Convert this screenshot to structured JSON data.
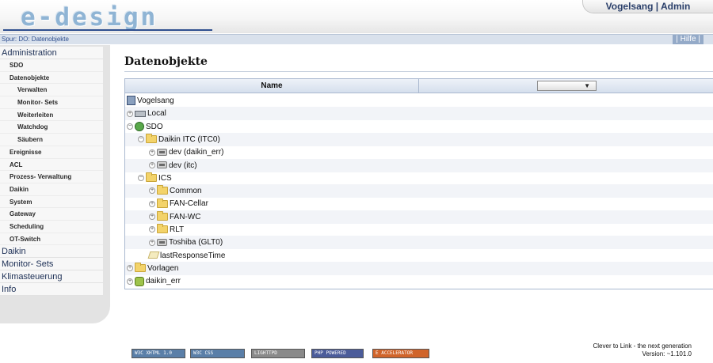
{
  "header": {
    "logo_text": "e-design",
    "user_label": "Vogelsang | Admin",
    "trail": "Spur: DO: Datenobjekte",
    "help_label": "| Hilfe |"
  },
  "sidebar": {
    "items": [
      {
        "label": "Administration",
        "level": 0
      },
      {
        "label": "SDO",
        "level": 1
      },
      {
        "label": "Datenobjekte",
        "level": 1
      },
      {
        "label": "Verwalten",
        "level": 2
      },
      {
        "label": "Monitor- Sets",
        "level": 2
      },
      {
        "label": "Weiterleiten",
        "level": 2
      },
      {
        "label": "Watchdog",
        "level": 2
      },
      {
        "label": "Säubern",
        "level": 2
      },
      {
        "label": "Ereignisse",
        "level": 1
      },
      {
        "label": "ACL",
        "level": 1
      },
      {
        "label": "Prozess- Verwaltung",
        "level": 1
      },
      {
        "label": "Daikin",
        "level": 1
      },
      {
        "label": "System",
        "level": 1
      },
      {
        "label": "Gateway",
        "level": 1
      },
      {
        "label": "Scheduling",
        "level": 1
      },
      {
        "label": "OT-Switch",
        "level": 1
      },
      {
        "label": "Daikin",
        "level": 0
      },
      {
        "label": "Monitor- Sets",
        "level": 0
      },
      {
        "label": "Klimasteuerung",
        "level": 0
      },
      {
        "label": "Info",
        "level": 0
      }
    ]
  },
  "main": {
    "title": "Datenobjekte",
    "column_name": "Name",
    "filter_value": "",
    "filter_arrow": "▼",
    "tree": [
      {
        "label": "Vogelsang",
        "depth": 0,
        "icon": "server-icon",
        "toggle": ""
      },
      {
        "label": "Local",
        "depth": 0,
        "icon": "drive-icon",
        "toggle": "+"
      },
      {
        "label": "SDO",
        "depth": 0,
        "icon": "globe-icon",
        "toggle": "−"
      },
      {
        "label": "Daikin ITC (ITC0)",
        "depth": 1,
        "icon": "folder-icon",
        "toggle": "−"
      },
      {
        "label": "dev (daikin_err)",
        "depth": 2,
        "icon": "device-icon",
        "toggle": "+"
      },
      {
        "label": "dev (itc)",
        "depth": 2,
        "icon": "device-icon",
        "toggle": "+"
      },
      {
        "label": "ICS",
        "depth": 1,
        "icon": "folder-icon",
        "toggle": "−"
      },
      {
        "label": "Common",
        "depth": 2,
        "icon": "folder-icon",
        "toggle": "+"
      },
      {
        "label": "FAN-Cellar",
        "depth": 2,
        "icon": "folder-icon",
        "toggle": "+"
      },
      {
        "label": "FAN-WC",
        "depth": 2,
        "icon": "folder-icon",
        "toggle": "+"
      },
      {
        "label": "RLT",
        "depth": 2,
        "icon": "folder-icon",
        "toggle": "+"
      },
      {
        "label": "Toshiba (GLT0)",
        "depth": 2,
        "icon": "device-icon",
        "toggle": "+"
      },
      {
        "label": "lastResponseTime",
        "depth": 2,
        "icon": "attribute-icon",
        "toggle": ""
      },
      {
        "label": "Vorlagen",
        "depth": 0,
        "icon": "folder-icon",
        "toggle": "+"
      },
      {
        "label": "daikin_err",
        "depth": 0,
        "icon": "error-object-icon",
        "toggle": "+"
      }
    ]
  },
  "footer": {
    "badges": [
      {
        "label": "W3C XHTML 1.0",
        "color": "#5a7fa8"
      },
      {
        "label": "W3C CSS",
        "color": "#5a7fa8"
      },
      {
        "label": "LIGHTTPD",
        "color": "#8a8a8a"
      },
      {
        "label": "PHP POWERED",
        "color": "#4b5c9a"
      },
      {
        "label": "E ACCELERATOR",
        "color": "#d0642a"
      }
    ],
    "line1": "Clever to Link - the next generation",
    "line2": "Version: ~1.101.0"
  }
}
